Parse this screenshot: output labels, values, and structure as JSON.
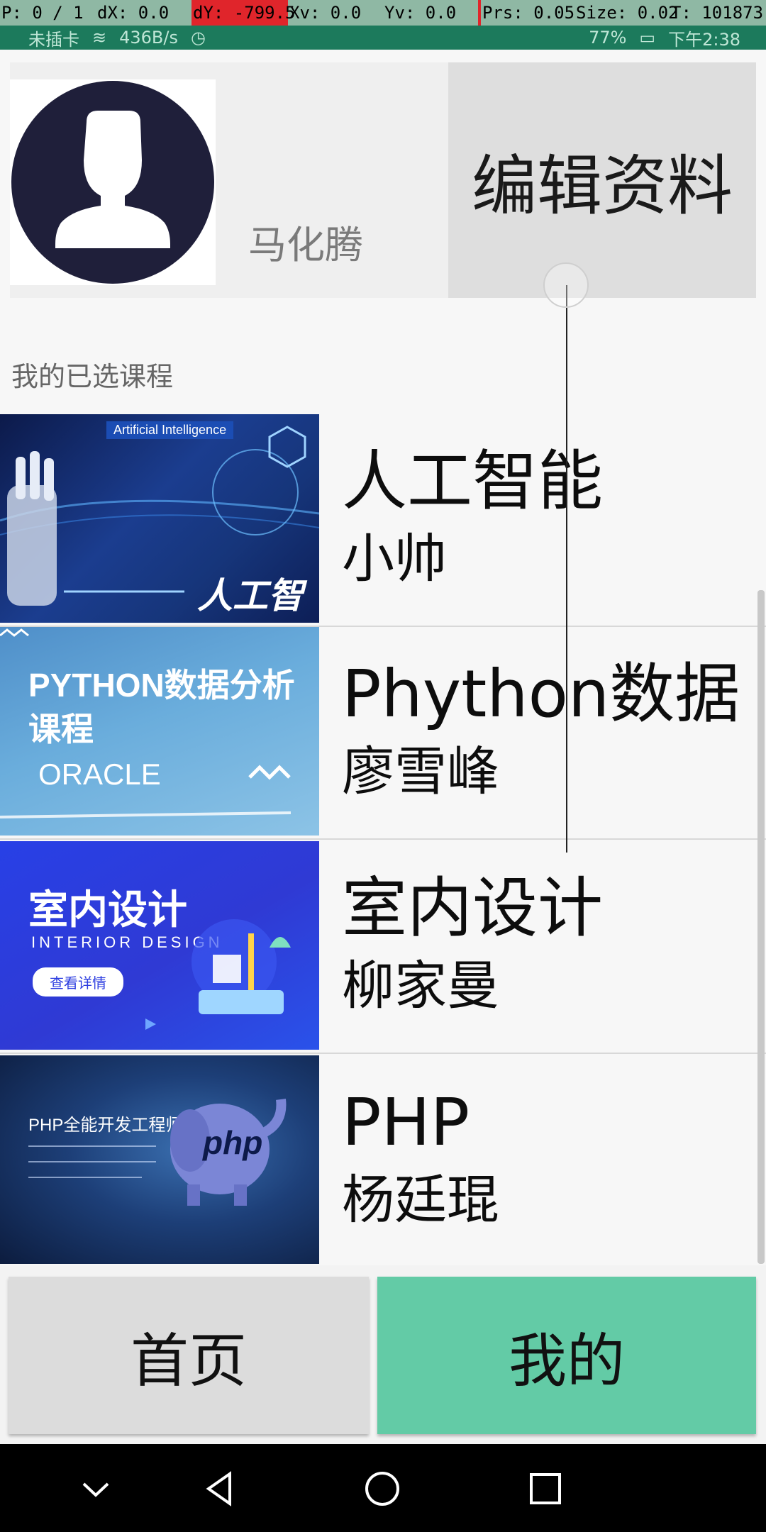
{
  "debug": {
    "pointer": "P: 0 / 1",
    "dx": "dX: 0.0",
    "dy": "dY: -799.5",
    "xv": "Xv: 0.0",
    "yv": "Yv: 0.0",
    "prs": "Prs: 0.05",
    "size": "Size: 0.02",
    "t": "T: 101873"
  },
  "status": {
    "carrier": "未插卡",
    "speed": "436B/s",
    "battery": "77%",
    "time": "下午2:38"
  },
  "profile": {
    "name": "马化腾",
    "edit_label": "编辑资料"
  },
  "section": {
    "title": "我的已选课程"
  },
  "courses": [
    {
      "title": "人工智能",
      "teacher": "小帅",
      "thumb_caption": "人工智能",
      "thumb_sub": "Artificial Intelligence"
    },
    {
      "title": "Phython数据",
      "teacher": "廖雪峰",
      "thumb_caption": "PYTHON数据分析",
      "thumb_line2": "课程",
      "thumb_sub": "ORACLE"
    },
    {
      "title": "室内设计",
      "teacher": "柳家曼",
      "thumb_caption": "室内设计",
      "thumb_sub": "INTERIOR DESIGN",
      "thumb_button": "查看详情"
    },
    {
      "title": "PHP",
      "teacher": "杨廷琨",
      "thumb_caption": "PHP全能开发工程师",
      "thumb_badge": "php"
    }
  ],
  "tabs": {
    "home": "首页",
    "mine": "我的"
  },
  "colors": {
    "accent": "#63cba6",
    "status_bar": "#1c7a5c"
  }
}
